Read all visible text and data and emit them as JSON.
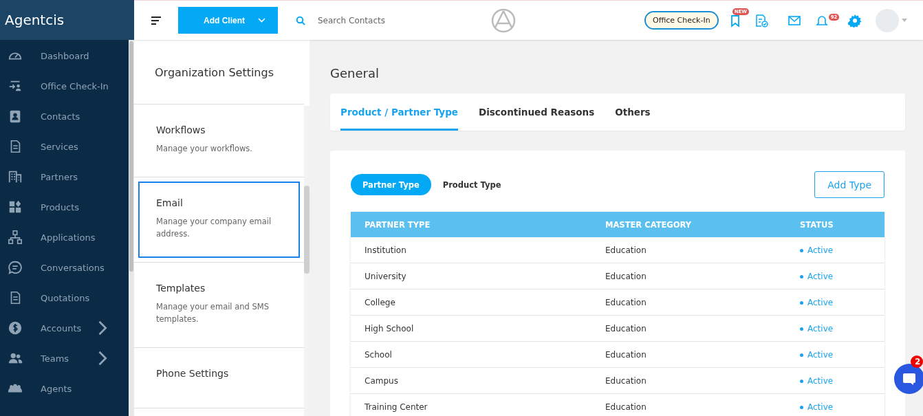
{
  "brand": {
    "logo": "Agentcis"
  },
  "sidebar": {
    "items": [
      {
        "label": "Dashboard",
        "has_children": false
      },
      {
        "label": "Office Check-In",
        "has_children": false
      },
      {
        "label": "Contacts",
        "has_children": false
      },
      {
        "label": "Services",
        "has_children": false
      },
      {
        "label": "Partners",
        "has_children": false
      },
      {
        "label": "Products",
        "has_children": false
      },
      {
        "label": "Applications",
        "has_children": false
      },
      {
        "label": "Conversations",
        "has_children": false
      },
      {
        "label": "Quotations",
        "has_children": false
      },
      {
        "label": "Accounts",
        "has_children": true
      },
      {
        "label": "Teams",
        "has_children": true
      },
      {
        "label": "Agents",
        "has_children": false
      }
    ]
  },
  "topbar": {
    "add_client": "Add Client",
    "search": {
      "placeholder": "Search Contacts"
    },
    "office_checkin": "Office Check-In",
    "new_badge": "NEW",
    "notification_count": "92"
  },
  "settings_panel": {
    "title": "Organization Settings",
    "items": [
      {
        "title": "Workflows",
        "description": "Manage your workflows.",
        "selected": false
      },
      {
        "title": "Email",
        "description": "Manage your company email address.",
        "selected": true
      },
      {
        "title": "Templates",
        "description": "Manage your email and SMS templates.",
        "selected": false
      },
      {
        "title": "Phone Settings",
        "selected": false
      }
    ]
  },
  "main": {
    "title": "General",
    "tabs": [
      {
        "label": "Product / Partner Type",
        "selected": true
      },
      {
        "label": "Discontinued Reasons",
        "selected": false
      },
      {
        "label": "Others",
        "selected": false
      }
    ],
    "type_toggle": [
      {
        "label": "Partner Type",
        "selected": true
      },
      {
        "label": "Product Type",
        "selected": false
      }
    ],
    "add_type": "Add Type",
    "table": {
      "columns": [
        "PARTNER TYPE",
        "MASTER CATEGORY",
        "STATUS"
      ],
      "rows": [
        {
          "partner_type": "Institution",
          "master_category": "Education",
          "status": "Active"
        },
        {
          "partner_type": "University",
          "master_category": "Education",
          "status": "Active"
        },
        {
          "partner_type": "College",
          "master_category": "Education",
          "status": "Active"
        },
        {
          "partner_type": "High School",
          "master_category": "Education",
          "status": "Active"
        },
        {
          "partner_type": "School",
          "master_category": "Education",
          "status": "Active"
        },
        {
          "partner_type": "Campus",
          "master_category": "Education",
          "status": "Active"
        },
        {
          "partner_type": "Training Center",
          "master_category": "Education",
          "status": "Active"
        }
      ]
    }
  },
  "chat": {
    "badge": "2"
  }
}
